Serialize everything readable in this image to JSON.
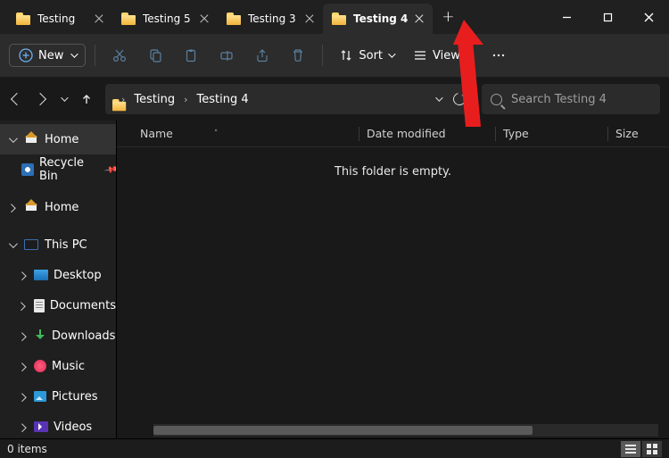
{
  "tabs": [
    {
      "label": "Testing"
    },
    {
      "label": "Testing 5"
    },
    {
      "label": "Testing 3"
    },
    {
      "label": "Testing 4"
    }
  ],
  "active_tab_index": 3,
  "toolbar": {
    "new_label": "New",
    "sort_label": "Sort",
    "view_label": "View"
  },
  "breadcrumb": {
    "items": [
      "Testing",
      "Testing 4"
    ]
  },
  "search": {
    "placeholder": "Search Testing 4"
  },
  "tree": {
    "home": "Home",
    "recycle": "Recycle Bin",
    "home2": "Home",
    "thispc": "This PC",
    "desktop": "Desktop",
    "documents": "Documents",
    "downloads": "Downloads",
    "music": "Music",
    "pictures": "Pictures",
    "videos": "Videos"
  },
  "columns": {
    "name": "Name",
    "date": "Date modified",
    "type": "Type",
    "size": "Size"
  },
  "empty_text": "This folder is empty.",
  "status": {
    "items": "0 items"
  }
}
